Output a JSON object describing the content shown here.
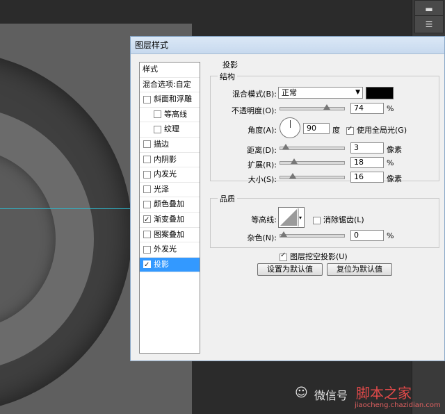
{
  "dialog": {
    "title": "图层样式"
  },
  "style_list": {
    "header": "样式",
    "blend_options": "混合选项:自定",
    "items": [
      {
        "label": "斜面和浮雕",
        "checked": false,
        "indent": false,
        "selected": false
      },
      {
        "label": "等高线",
        "checked": false,
        "indent": true,
        "selected": false
      },
      {
        "label": "纹理",
        "checked": false,
        "indent": true,
        "selected": false
      },
      {
        "label": "描边",
        "checked": false,
        "indent": false,
        "selected": false
      },
      {
        "label": "内阴影",
        "checked": false,
        "indent": false,
        "selected": false
      },
      {
        "label": "内发光",
        "checked": false,
        "indent": false,
        "selected": false
      },
      {
        "label": "光泽",
        "checked": false,
        "indent": false,
        "selected": false
      },
      {
        "label": "颜色叠加",
        "checked": false,
        "indent": false,
        "selected": false
      },
      {
        "label": "渐变叠加",
        "checked": true,
        "indent": false,
        "selected": false
      },
      {
        "label": "图案叠加",
        "checked": false,
        "indent": false,
        "selected": false
      },
      {
        "label": "外发光",
        "checked": false,
        "indent": false,
        "selected": false
      },
      {
        "label": "投影",
        "checked": true,
        "indent": false,
        "selected": true
      }
    ]
  },
  "shadow": {
    "section_title": "投影",
    "structure_title": "结构",
    "blend_mode_label": "混合模式(B):",
    "blend_mode_value": "正常",
    "blend_color": "#000000",
    "opacity_label": "不透明度(O):",
    "opacity_value": "74",
    "opacity_unit": "%",
    "angle_label": "角度(A):",
    "angle_value": "90",
    "angle_unit": "度",
    "global_light_label": "使用全局光(G)",
    "global_light_checked": true,
    "distance_label": "距离(D):",
    "distance_value": "3",
    "distance_unit": "像素",
    "spread_label": "扩展(R):",
    "spread_value": "18",
    "spread_unit": "%",
    "size_label": "大小(S):",
    "size_value": "16",
    "size_unit": "像素",
    "quality_title": "品质",
    "contour_label": "等高线:",
    "antialias_label": "消除锯齿(L)",
    "noise_label": "杂色(N):",
    "noise_value": "0",
    "noise_unit": "%",
    "knockout_label": "图层挖空投影(U)",
    "knockout_checked": true,
    "set_default_button": "设置为默认值",
    "reset_default_button": "复位为默认值"
  },
  "watermark": {
    "wechat": "微信号",
    "site": "脚本之家",
    "url": "jiaocheng.chazidian.com"
  },
  "slider_levels": {
    "opacity": 0.74,
    "distance": 0.03,
    "spread": 0.18,
    "size": 0.16,
    "noise": 0.0
  }
}
